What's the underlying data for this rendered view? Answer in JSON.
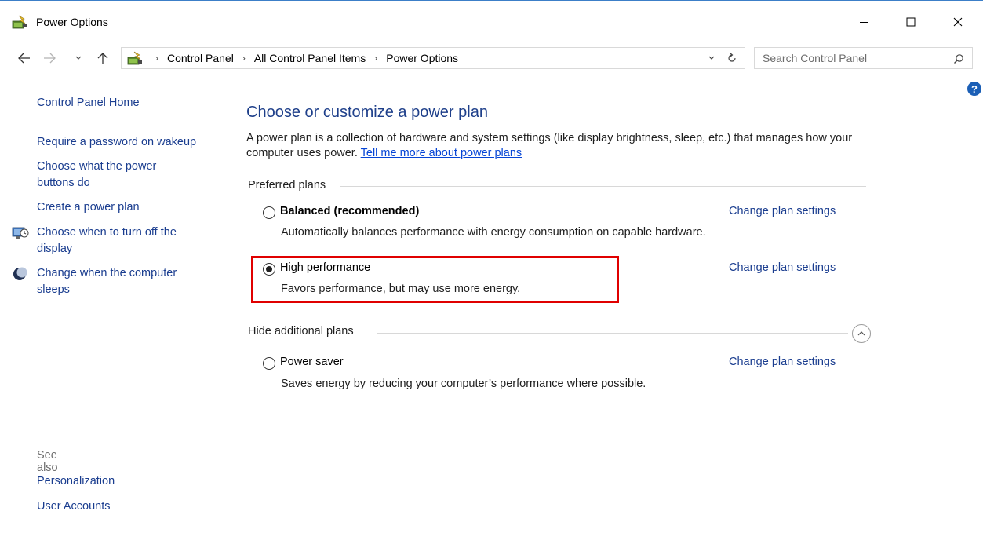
{
  "window": {
    "title": "Power Options",
    "accent": "#3c7fc8"
  },
  "address": {
    "crumbs": [
      "Control Panel",
      "All Control Panel Items",
      "Power Options"
    ],
    "separator": "›"
  },
  "search": {
    "placeholder": "Search Control Panel"
  },
  "help": {
    "label": "?"
  },
  "sidebar": {
    "home": "Control Panel Home",
    "items": [
      {
        "label": "Require a password on wakeup"
      },
      {
        "label": "Choose what the power buttons do"
      },
      {
        "label": "Create a power plan"
      },
      {
        "label": "Choose when to turn off the display",
        "icon": "display-power-icon"
      },
      {
        "label": "Change when the computer sleeps",
        "icon": "moon-icon"
      }
    ],
    "see_also_label": "See also",
    "see_also": [
      "Personalization",
      "User Accounts"
    ]
  },
  "main": {
    "title": "Choose or customize a power plan",
    "description": "A power plan is a collection of hardware and system settings (like display brightness, sleep, etc.) that manages how your computer uses power.",
    "learn_more": "Tell me more about power plans",
    "preferred_label": "Preferred plans",
    "additional_label": "Hide additional plans",
    "change_label": "Change plan settings",
    "plans": [
      {
        "name": "Balanced (recommended)",
        "desc": "Automatically balances performance with energy consumption on capable hardware.",
        "selected": false
      },
      {
        "name": "High performance",
        "desc": "Favors performance, but may use more energy.",
        "selected": true
      },
      {
        "name": "Power saver",
        "desc": "Saves energy by reducing your computer’s performance where possible.",
        "selected": false
      }
    ],
    "highlight_color": "#e00000"
  }
}
